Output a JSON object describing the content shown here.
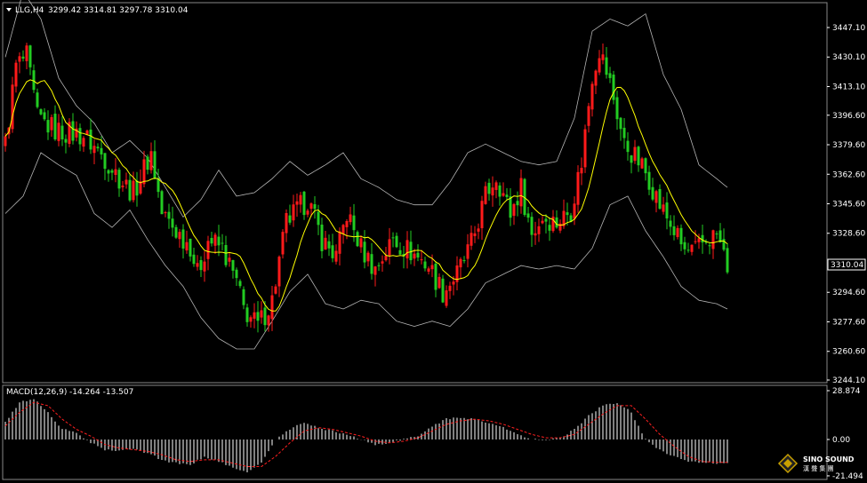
{
  "header": {
    "symbol": "LLG,H4",
    "ohlc": "3299.42 3314.81 3297.78 3310.04"
  },
  "macd_header": {
    "label": "MACD(12,26,9)",
    "values": "-14.264 -13.507"
  },
  "current_price_label": "3310.04",
  "logo": {
    "brand": "SINO SOUND",
    "sub": "漢 聲 集 團"
  },
  "chart_data": [
    {
      "type": "candlestick",
      "title": "LLG,H4",
      "price_ticks": [
        "3447.10",
        "3430.10",
        "3413.10",
        "3396.60",
        "3379.60",
        "3362.60",
        "3345.60",
        "3328.60",
        "3310.04",
        "3294.60",
        "3277.60",
        "3260.60",
        "3244.10"
      ],
      "ylim": [
        3244.1,
        3460
      ],
      "current_price": 3310.04,
      "colors": {
        "up": "#ff1a1a",
        "down": "#22cc22",
        "ma": "#ffff00",
        "bands": "#b4b4b4"
      },
      "overlays": [
        "moving-average",
        "bollinger-bands"
      ],
      "close_path": [
        [
          0,
          3380
        ],
        [
          3,
          3425
        ],
        [
          6,
          3430
        ],
        [
          9,
          3395
        ],
        [
          14,
          3388
        ],
        [
          22,
          3385
        ],
        [
          28,
          3372
        ],
        [
          33,
          3358
        ],
        [
          36,
          3352
        ],
        [
          41,
          3375
        ],
        [
          44,
          3340
        ],
        [
          48,
          3330
        ],
        [
          52,
          3322
        ],
        [
          54,
          3305
        ],
        [
          57,
          3325
        ],
        [
          61,
          3320
        ],
        [
          65,
          3300
        ],
        [
          67,
          3285
        ],
        [
          71,
          3275
        ],
        [
          75,
          3290
        ],
        [
          79,
          3335
        ],
        [
          85,
          3348
        ],
        [
          89,
          3325
        ],
        [
          93,
          3315
        ],
        [
          96,
          3340
        ],
        [
          100,
          3320
        ],
        [
          104,
          3308
        ],
        [
          109,
          3325
        ],
        [
          114,
          3318
        ],
        [
          119,
          3310
        ],
        [
          123,
          3295
        ],
        [
          127,
          3305
        ],
        [
          131,
          3322
        ],
        [
          135,
          3350
        ],
        [
          138,
          3362
        ],
        [
          142,
          3340
        ],
        [
          145,
          3355
        ],
        [
          148,
          3328
        ],
        [
          151,
          3338
        ],
        [
          155,
          3335
        ],
        [
          159,
          3342
        ],
        [
          162,
          3370
        ],
        [
          165,
          3420
        ],
        [
          167,
          3435
        ],
        [
          170,
          3415
        ],
        [
          174,
          3380
        ],
        [
          178,
          3370
        ],
        [
          181,
          3360
        ],
        [
          184,
          3345
        ],
        [
          188,
          3330
        ],
        [
          191,
          3318
        ],
        [
          194,
          3318
        ],
        [
          197,
          3325
        ],
        [
          200,
          3328
        ],
        [
          203,
          3310
        ]
      ],
      "upper_band": [
        [
          0,
          3430
        ],
        [
          5,
          3468
        ],
        [
          10,
          3452
        ],
        [
          15,
          3418
        ],
        [
          20,
          3402
        ],
        [
          25,
          3392
        ],
        [
          30,
          3375
        ],
        [
          35,
          3382
        ],
        [
          40,
          3372
        ],
        [
          45,
          3355
        ],
        [
          50,
          3338
        ],
        [
          55,
          3348
        ],
        [
          60,
          3365
        ],
        [
          65,
          3350
        ],
        [
          70,
          3352
        ],
        [
          75,
          3360
        ],
        [
          80,
          3370
        ],
        [
          85,
          3362
        ],
        [
          90,
          3368
        ],
        [
          95,
          3375
        ],
        [
          100,
          3360
        ],
        [
          105,
          3355
        ],
        [
          110,
          3348
        ],
        [
          115,
          3345
        ],
        [
          120,
          3345
        ],
        [
          125,
          3358
        ],
        [
          130,
          3375
        ],
        [
          135,
          3380
        ],
        [
          140,
          3375
        ],
        [
          145,
          3370
        ],
        [
          150,
          3368
        ],
        [
          155,
          3370
        ],
        [
          160,
          3395
        ],
        [
          165,
          3445
        ],
        [
          170,
          3452
        ],
        [
          175,
          3448
        ],
        [
          180,
          3455
        ],
        [
          185,
          3420
        ],
        [
          190,
          3400
        ],
        [
          195,
          3368
        ],
        [
          200,
          3360
        ],
        [
          203,
          3355
        ]
      ],
      "middle_band": [
        [
          0,
          3370
        ],
        [
          5,
          3405
        ],
        [
          10,
          3420
        ],
        [
          15,
          3390
        ],
        [
          20,
          3380
        ],
        [
          25,
          3368
        ],
        [
          30,
          3355
        ],
        [
          35,
          3362
        ],
        [
          40,
          3348
        ],
        [
          45,
          3335
        ],
        [
          50,
          3320
        ],
        [
          55,
          3315
        ],
        [
          60,
          3325
        ],
        [
          65,
          3310
        ],
        [
          70,
          3300
        ],
        [
          75,
          3318
        ],
        [
          80,
          3332
        ],
        [
          85,
          3335
        ],
        [
          90,
          3328
        ],
        [
          95,
          3330
        ],
        [
          100,
          3325
        ],
        [
          105,
          3310
        ],
        [
          110,
          3308
        ],
        [
          115,
          3310
        ],
        [
          120,
          3308
        ],
        [
          125,
          3315
        ],
        [
          130,
          3330
        ],
        [
          135,
          3340
        ],
        [
          140,
          3345
        ],
        [
          145,
          3342
        ],
        [
          150,
          3340
        ],
        [
          155,
          3340
        ],
        [
          160,
          3355
        ],
        [
          165,
          3390
        ],
        [
          170,
          3405
        ],
        [
          175,
          3395
        ],
        [
          180,
          3385
        ],
        [
          185,
          3365
        ],
        [
          190,
          3345
        ],
        [
          195,
          3330
        ],
        [
          200,
          3325
        ],
        [
          203,
          3320
        ]
      ],
      "lower_band": [
        [
          0,
          3340
        ],
        [
          5,
          3350
        ],
        [
          10,
          3375
        ],
        [
          15,
          3368
        ],
        [
          20,
          3362
        ],
        [
          25,
          3340
        ],
        [
          30,
          3332
        ],
        [
          35,
          3342
        ],
        [
          40,
          3325
        ],
        [
          45,
          3310
        ],
        [
          50,
          3298
        ],
        [
          55,
          3280
        ],
        [
          60,
          3268
        ],
        [
          65,
          3262
        ],
        [
          70,
          3262
        ],
        [
          75,
          3278
        ],
        [
          80,
          3295
        ],
        [
          85,
          3305
        ],
        [
          90,
          3288
        ],
        [
          95,
          3285
        ],
        [
          100,
          3290
        ],
        [
          105,
          3288
        ],
        [
          110,
          3278
        ],
        [
          115,
          3275
        ],
        [
          120,
          3278
        ],
        [
          125,
          3275
        ],
        [
          130,
          3285
        ],
        [
          135,
          3300
        ],
        [
          140,
          3305
        ],
        [
          145,
          3310
        ],
        [
          150,
          3308
        ],
        [
          155,
          3310
        ],
        [
          160,
          3308
        ],
        [
          165,
          3320
        ],
        [
          170,
          3345
        ],
        [
          175,
          3350
        ],
        [
          180,
          3330
        ],
        [
          185,
          3315
        ],
        [
          190,
          3298
        ],
        [
          195,
          3290
        ],
        [
          200,
          3288
        ],
        [
          203,
          3285
        ]
      ]
    },
    {
      "type": "bar",
      "title": "MACD(12,26,9)",
      "ticks": [
        "28.874",
        "0.00",
        "-21.494"
      ],
      "ylim": [
        -21.494,
        28.874
      ],
      "colors": {
        "histogram": "#ffffff",
        "signal": "#ff2020"
      },
      "histogram_path": [
        [
          0,
          10
        ],
        [
          4,
          22
        ],
        [
          8,
          24
        ],
        [
          12,
          16
        ],
        [
          16,
          6
        ],
        [
          20,
          4
        ],
        [
          24,
          -2
        ],
        [
          28,
          -6
        ],
        [
          32,
          -7
        ],
        [
          36,
          -5
        ],
        [
          40,
          -8
        ],
        [
          44,
          -12
        ],
        [
          48,
          -14
        ],
        [
          52,
          -15
        ],
        [
          56,
          -10
        ],
        [
          60,
          -13
        ],
        [
          64,
          -17
        ],
        [
          68,
          -19
        ],
        [
          72,
          -14
        ],
        [
          76,
          0
        ],
        [
          80,
          6
        ],
        [
          84,
          10
        ],
        [
          88,
          7
        ],
        [
          92,
          5
        ],
        [
          96,
          3
        ],
        [
          100,
          0
        ],
        [
          104,
          -3
        ],
        [
          108,
          -2
        ],
        [
          112,
          0
        ],
        [
          116,
          2
        ],
        [
          120,
          8
        ],
        [
          124,
          12
        ],
        [
          128,
          13
        ],
        [
          132,
          12
        ],
        [
          136,
          10
        ],
        [
          140,
          7
        ],
        [
          144,
          3
        ],
        [
          148,
          0
        ],
        [
          152,
          0
        ],
        [
          156,
          1
        ],
        [
          160,
          6
        ],
        [
          164,
          14
        ],
        [
          168,
          20
        ],
        [
          172,
          22
        ],
        [
          176,
          16
        ],
        [
          180,
          0
        ],
        [
          184,
          -6
        ],
        [
          188,
          -10
        ],
        [
          192,
          -13
        ],
        [
          196,
          -14
        ],
        [
          200,
          -14
        ],
        [
          203,
          -14
        ]
      ],
      "signal_path": [
        [
          0,
          8
        ],
        [
          4,
          16
        ],
        [
          8,
          22
        ],
        [
          12,
          20
        ],
        [
          16,
          12
        ],
        [
          20,
          6
        ],
        [
          24,
          2
        ],
        [
          28,
          -3
        ],
        [
          32,
          -5
        ],
        [
          36,
          -6
        ],
        [
          40,
          -7
        ],
        [
          44,
          -9
        ],
        [
          48,
          -12
        ],
        [
          52,
          -13
        ],
        [
          56,
          -12
        ],
        [
          60,
          -12
        ],
        [
          64,
          -14
        ],
        [
          68,
          -16
        ],
        [
          72,
          -16
        ],
        [
          76,
          -10
        ],
        [
          80,
          -2
        ],
        [
          84,
          5
        ],
        [
          88,
          7
        ],
        [
          92,
          6
        ],
        [
          96,
          4
        ],
        [
          100,
          2
        ],
        [
          104,
          -1
        ],
        [
          108,
          -2
        ],
        [
          112,
          -1
        ],
        [
          116,
          1
        ],
        [
          120,
          5
        ],
        [
          124,
          9
        ],
        [
          128,
          11
        ],
        [
          132,
          12
        ],
        [
          136,
          11
        ],
        [
          140,
          9
        ],
        [
          144,
          6
        ],
        [
          148,
          3
        ],
        [
          152,
          1
        ],
        [
          156,
          1
        ],
        [
          160,
          3
        ],
        [
          164,
          9
        ],
        [
          168,
          15
        ],
        [
          172,
          20
        ],
        [
          176,
          20
        ],
        [
          180,
          12
        ],
        [
          184,
          3
        ],
        [
          188,
          -4
        ],
        [
          192,
          -10
        ],
        [
          196,
          -13
        ],
        [
          200,
          -13.5
        ],
        [
          203,
          -13.5
        ]
      ]
    }
  ]
}
